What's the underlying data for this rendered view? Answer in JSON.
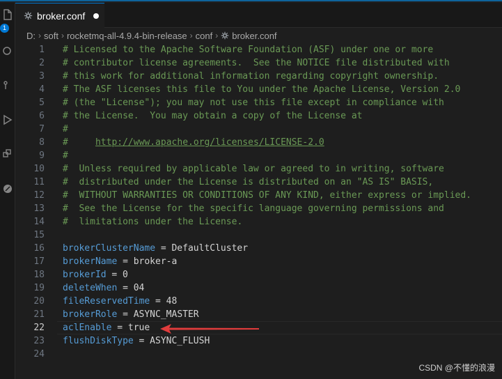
{
  "activity": {
    "badge_count": "1"
  },
  "tab": {
    "title": "broker.conf"
  },
  "breadcrumb": [
    "D:",
    "soft",
    "rocketmq-all-4.9.4-bin-release",
    "conf",
    "broker.conf"
  ],
  "lines": [
    {
      "n": "1",
      "comment": "# Licensed to the Apache Software Foundation (ASF) under one or more"
    },
    {
      "n": "2",
      "comment": "# contributor license agreements.  See the NOTICE file distributed with"
    },
    {
      "n": "3",
      "comment": "# this work for additional information regarding copyright ownership."
    },
    {
      "n": "4",
      "comment": "# The ASF licenses this file to You under the Apache License, Version 2.0"
    },
    {
      "n": "5",
      "comment": "# (the \"License\"); you may not use this file except in compliance with"
    },
    {
      "n": "6",
      "comment": "# the License.  You may obtain a copy of the License at"
    },
    {
      "n": "7",
      "comment": "#"
    },
    {
      "n": "8",
      "comment": "#     ",
      "url": "http://www.apache.org/licenses/LICENSE-2.0"
    },
    {
      "n": "9",
      "comment": "#"
    },
    {
      "n": "10",
      "comment": "#  Unless required by applicable law or agreed to in writing, software"
    },
    {
      "n": "11",
      "comment": "#  distributed under the License is distributed on an \"AS IS\" BASIS,"
    },
    {
      "n": "12",
      "comment": "#  WITHOUT WARRANTIES OR CONDITIONS OF ANY KIND, either express or implied."
    },
    {
      "n": "13",
      "comment": "#  See the License for the specific language governing permissions and"
    },
    {
      "n": "14",
      "comment": "#  limitations under the License."
    },
    {
      "n": "15"
    },
    {
      "n": "16",
      "key": "brokerClusterName",
      "value": "DefaultCluster"
    },
    {
      "n": "17",
      "key": "brokerName",
      "value": "broker-a"
    },
    {
      "n": "18",
      "key": "brokerId",
      "value": "0"
    },
    {
      "n": "19",
      "key": "deleteWhen",
      "value": "04"
    },
    {
      "n": "20",
      "key": "fileReservedTime",
      "value": "48"
    },
    {
      "n": "21",
      "key": "brokerRole",
      "value": "ASYNC_MASTER"
    },
    {
      "n": "22",
      "key": "aclEnable",
      "value": "true",
      "current": true
    },
    {
      "n": "23",
      "key": "flushDiskType",
      "value": "ASYNC_FLUSH"
    },
    {
      "n": "24"
    }
  ],
  "operator": "=",
  "watermark": "CSDN @不懂的浪漫",
  "colors": {
    "accent": "#0078d4",
    "annotation_arrow": "#e03c3c",
    "comment": "#6a9955",
    "key": "#569cd6"
  }
}
